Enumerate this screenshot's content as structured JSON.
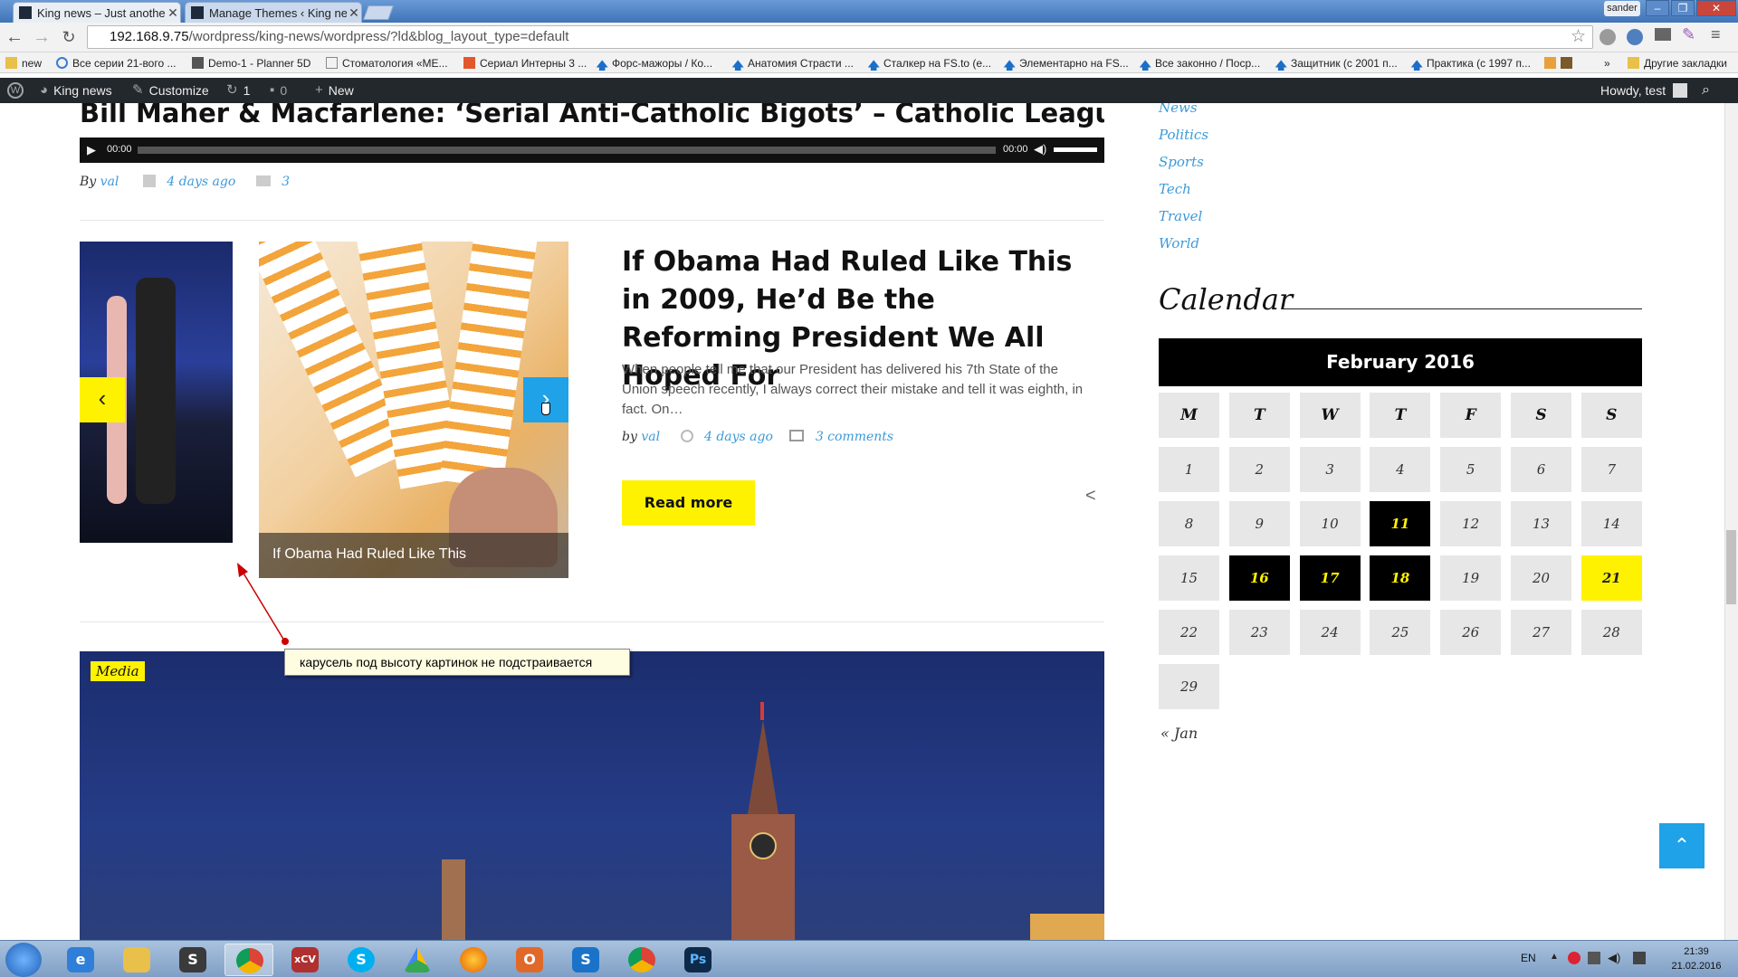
{
  "browser": {
    "tabs": [
      {
        "label": "King news – Just another W",
        "active": true
      },
      {
        "label": "Manage Themes ‹ King ne",
        "active": false
      }
    ],
    "profile": "sander",
    "url_host": "192.168.9.75",
    "url_path": "/wordpress/king-news/wordpress/?ld&blog_layout_type=default",
    "bookmarks": [
      "new",
      "Все серии 21-вого ...",
      "Demo-1 - Planner 5D",
      "Стоматология «МЕ...",
      "Сериал Интерны 3 ...",
      "Форс-мажоры / Ко...",
      "Анатомия Страсти ...",
      "Сталкер на FS.to (е...",
      "Элементарно на FS...",
      "Все законно / Поср...",
      "Защитник (с 2001 п...",
      "Практика (с 1997 п..."
    ],
    "bookmarks_more": "»",
    "other_bookmarks": "Другие закладки"
  },
  "adminbar": {
    "site": "King news",
    "customize": "Customize",
    "updates": "1",
    "comments": "0",
    "new": "New",
    "howdy": "Howdy, test"
  },
  "post1": {
    "title": "Bill Maher & Macfarlene: ‘Serial Anti-Catholic Bigots’ – Catholic League",
    "audio_start": "00:00",
    "audio_end": "00:00",
    "by": "By",
    "author": "val",
    "date": "4 days ago",
    "comments": "3"
  },
  "post2": {
    "title": "If Obama Had Ruled Like This in 2009, He’d Be the Reforming President We All Hoped For",
    "excerpt": "When people tell me that our President has delivered his 7th State of the Union speech recently, I always correct their mistake and tell it was eighth, in fact. On…",
    "by": "by",
    "author": "val",
    "date": "4 days ago",
    "comments": "3 comments",
    "read_more": "Read more",
    "carousel_caption": "If Obama Had Ruled Like This",
    "prev": "‹",
    "next": "›"
  },
  "post3": {
    "badge": "Media"
  },
  "annotation": "карусель под высоту картинок не подстраивается",
  "sidebar": {
    "categories": [
      "News",
      "Politics",
      "Sports",
      "Tech",
      "Travel",
      "World"
    ],
    "calendar_title": "Calendar",
    "month": "February 2016",
    "weekdays": [
      "M",
      "T",
      "W",
      "T",
      "F",
      "S",
      "S"
    ],
    "prev_month": "« Jan",
    "highlighted_days": [
      11,
      16,
      17,
      18
    ],
    "today": 21
  },
  "taskbar": {
    "lang": "EN",
    "time": "21:39",
    "date": "21.02.2016"
  },
  "colors": {
    "accent_yellow": "#fff200",
    "link_blue": "#3d9ad8",
    "admin_bar": "#23282d",
    "to_top_blue": "#1fa2e8"
  }
}
